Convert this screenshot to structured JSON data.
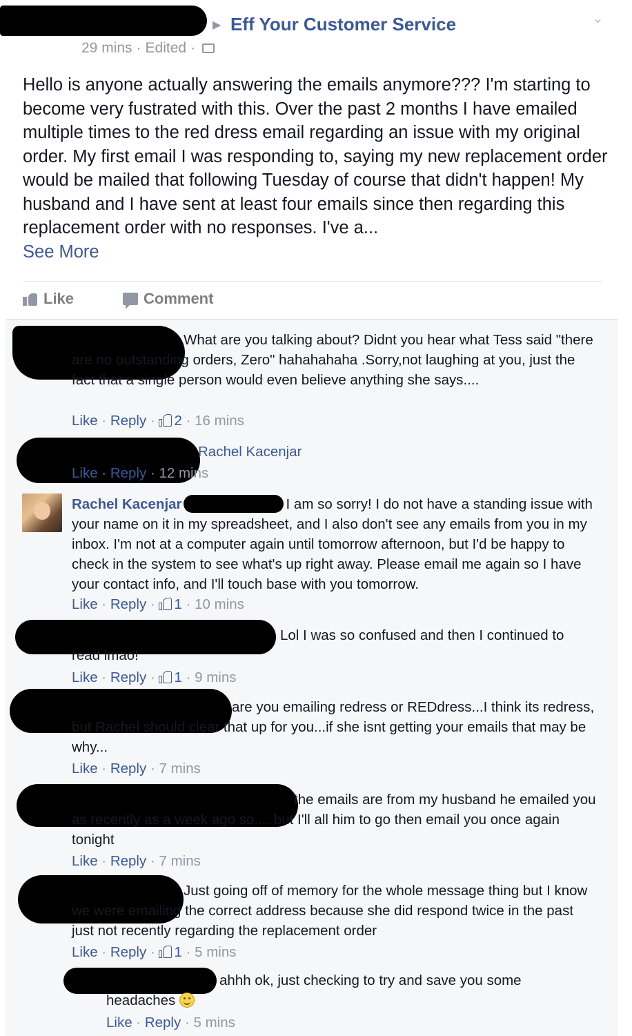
{
  "post": {
    "group_name": "Eff Your Customer Service",
    "time": "29 mins",
    "edited": "Edited",
    "body": "Hello is anyone actually answering the emails anymore??? I'm starting to become very fustrated with this. Over the past 2 months I have emailed multiple times to the red dress email regarding an issue with my original order. My first email I was responding to, saying my new replacement order would be mailed that following Tuesday of course that didn't happen! My husband and I have sent at least four emails since then regarding this replacement order with no responses. I've a...",
    "see_more": "See More",
    "like_label": "Like",
    "comment_label": "Comment"
  },
  "comments": [
    {
      "text": "What are you talking about? Didnt you hear what Tess said \"there are no outstanding orders, Zero\" hahahahaha .Sorry,not laughing at you, just the fact that a single person would even believe anything she says....",
      "like": "Like",
      "reply": "Reply",
      "likes": "2",
      "time": "16 mins"
    },
    {
      "text": "Rachel Kacenjar",
      "like": "Like",
      "reply": "Reply",
      "time": "12 mins"
    },
    {
      "author": "Rachel Kacenjar",
      "text": "I am so sorry! I do not have a standing issue with your name on it in my spreadsheet, and I also don't see any emails from you in my inbox. I'm not at a computer again until tomorrow afternoon, but I'd be happy to check in the system to see what's up right away. Please email me again so I have your contact info, and I'll touch base with you tomorrow.",
      "like": "Like",
      "reply": "Reply",
      "likes": "1",
      "time": "10 mins"
    },
    {
      "text": "Lol I was so confused and then I continued to read lmao!",
      "like": "Like",
      "reply": "Reply",
      "likes": "1",
      "time": "9 mins"
    },
    {
      "text": "are you emailing redress or REDdress...I think its redress, but Rachel should clear that up for you...if she isnt getting your emails that may be why...",
      "like": "Like",
      "reply": "Reply",
      "time": "7 mins"
    },
    {
      "text": "the emails are from my husband he emailed you as recently as a week ago so.... but I'll all him to go then email you once again tonight",
      "like": "Like",
      "reply": "Reply",
      "time": "7 mins"
    },
    {
      "text": "Just going off of memory for the whole message thing but I know we were emailing the correct address because she did respond twice in the past just not recently regarding the replacement order",
      "like": "Like",
      "reply": "Reply",
      "likes": "1",
      "time": "5 mins"
    },
    {
      "text": "ahhh ok, just checking to try and save you some headaches",
      "like": "Like",
      "reply": "Reply",
      "time": "5 mins"
    }
  ]
}
